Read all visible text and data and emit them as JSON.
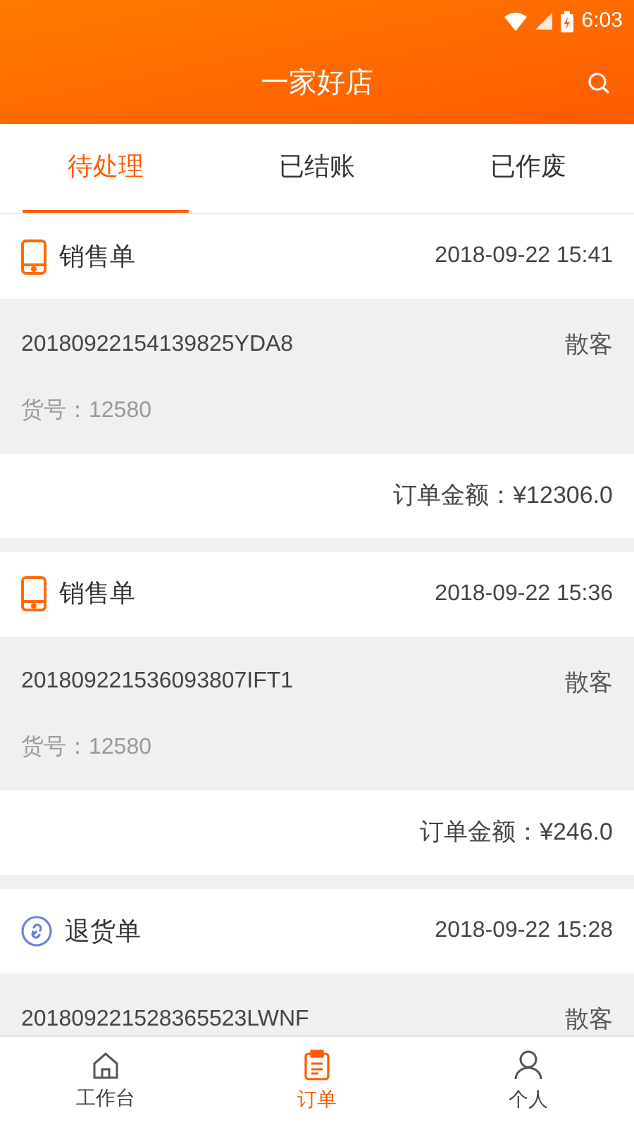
{
  "status_bar": {
    "time": "6:03"
  },
  "header": {
    "title": "一家好店"
  },
  "tabs": [
    {
      "label": "待处理",
      "selected": true
    },
    {
      "label": "已结账",
      "selected": false
    },
    {
      "label": "已作废",
      "selected": false
    }
  ],
  "orders": [
    {
      "kind": "sale",
      "type": "销售单",
      "time": "2018-09-22 15:41",
      "number": "20180922154139825YDA8",
      "customer": "散客",
      "item_no": "货号：12580",
      "total": "订单金额：¥12306.0"
    },
    {
      "kind": "sale",
      "type": "销售单",
      "time": "2018-09-22 15:36",
      "number": "201809221536093807IFT1",
      "customer": "散客",
      "item_no": "货号：12580",
      "total": "订单金额：¥246.0"
    },
    {
      "kind": "return",
      "type": "退货单",
      "time": "2018-09-22 15:28",
      "number": "201809221528365523LWNF",
      "customer": "散客"
    }
  ],
  "bottom_nav": [
    {
      "kind": "home",
      "label": "工作台",
      "selected": false
    },
    {
      "kind": "orders",
      "label": "订单",
      "selected": true
    },
    {
      "kind": "person",
      "label": "个人",
      "selected": false
    }
  ]
}
